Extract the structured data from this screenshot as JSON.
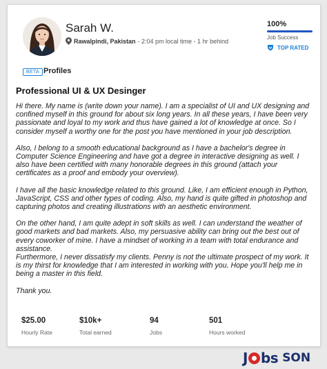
{
  "profile": {
    "name": "Sarah W.",
    "city": "Rawalpindi, Pakistan",
    "time_info": "- 2:04 pm local time - 1 hr behind",
    "job_success_value": "100%",
    "job_success_fraction": 1.0,
    "job_success_label": "Job Success",
    "top_rated_label": "TOP RATED"
  },
  "profiles_section": {
    "beta_badge": "BETA",
    "heading": "Profiles"
  },
  "listing": {
    "title": "Professional UI & UX Desinger",
    "paragraphs": [
      "Hi there. My name is (write down your name). I am a specialist of UI and UX designing and confined myself in this ground for about six long years. In all these years, I have been very passionate and loyal to my work and thus have gained a lot of knowledge at once. So I consider myself a worthy one for the post you have mentioned in your job description.",
      "Also, I belong to a smooth educational background as I have a bachelor's degree in Computer Science Engineering and have got a degree in interactive designing as well. I also have been certified with many honorable degrees in this ground (attach your certificates as a proof and embody your overview).",
      "I have all the basic knowledge related to this ground. Like, I am efficient enough in Python, JavaScript, CSS and other types of coding. Also, my hand is quite gifted in photoshop and capturing photos and creating illustrations with an aesthetic environment.",
      "On the other hand, I am quite adept in soft skills as well. I can understand the weather of good markets and bad markets. Also, my persuasive ability can bring out the best out of every coworker of mine. I have a mindset of working in a team with total endurance and assistance.",
      "Furthermore, I never dissatisfy my clients. Penny is not the ultimate prospect of my work. It is my thirst for knowledge that I am interested in working with you. Hope you'll help me in being a master in this field.",
      "Thank you."
    ]
  },
  "stats": [
    {
      "value": "$25.00",
      "label": "Hourly Rate"
    },
    {
      "value": "$10k+",
      "label": "Total earned"
    },
    {
      "value": "94",
      "label": "Jobs"
    },
    {
      "value": "501",
      "label": "Hours worked"
    }
  ],
  "watermark": {
    "brand_left": "Jobs",
    "brand_right": "SON"
  },
  "colors": {
    "accent_blue": "#1e7fd8",
    "progress_blue": "#1f57c3",
    "logo_navy": "#1b2f6b",
    "logo_red": "#d62a2a"
  },
  "icons": {
    "location": "map-pin-icon",
    "top_rated": "shield-badge-icon",
    "avatar": "profile-photo"
  }
}
